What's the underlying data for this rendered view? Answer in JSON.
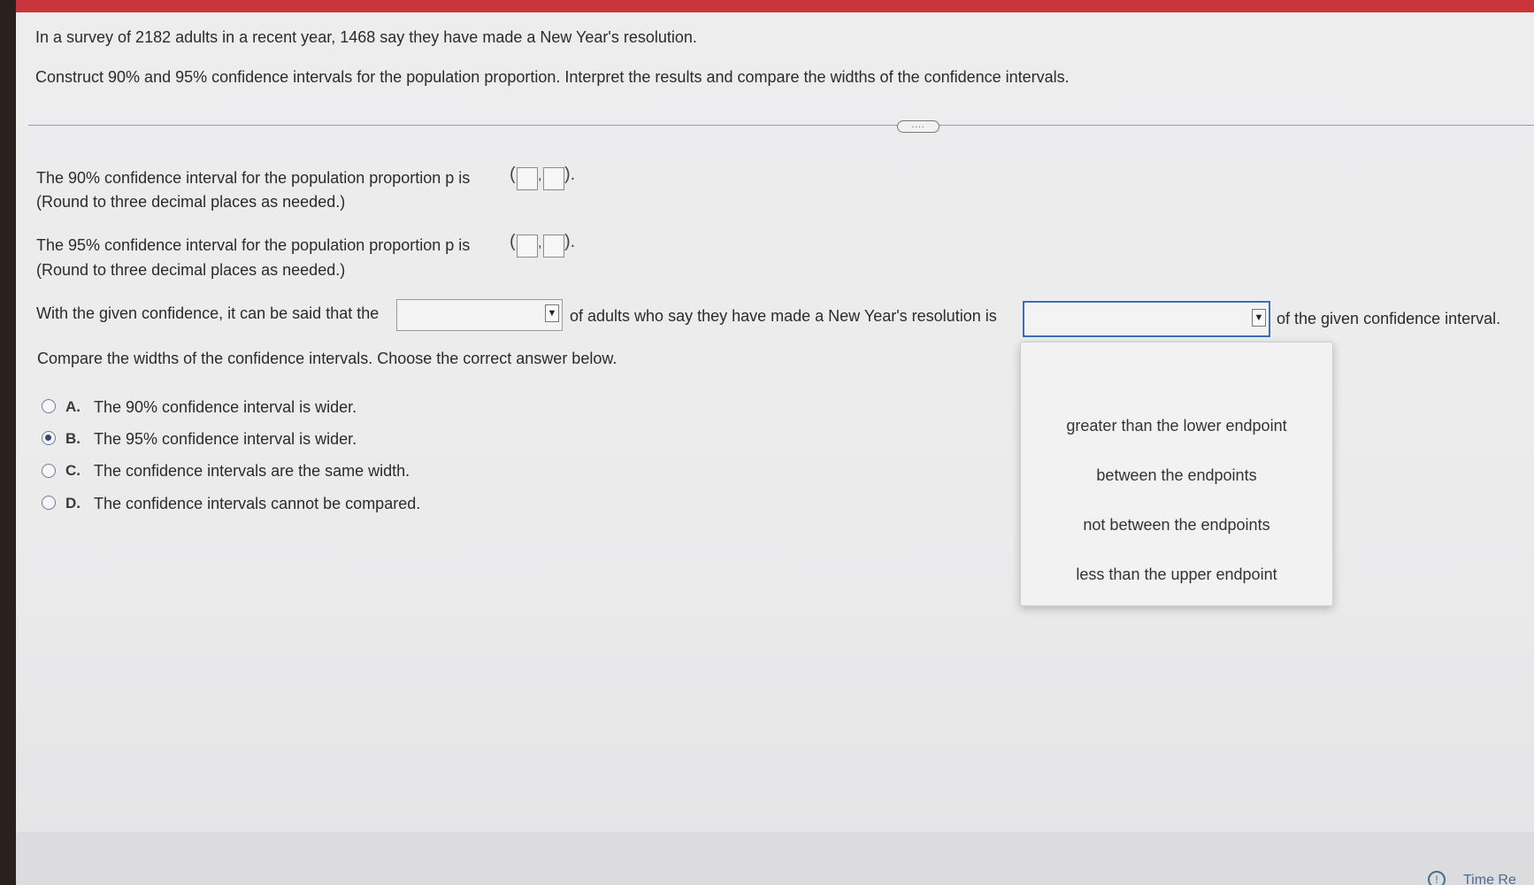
{
  "question": {
    "line1": "In a survey of 2182 adults in a recent year, 1468 say they have made a New Year's resolution.",
    "line2": "Construct 90% and 95% confidence intervals for the population proportion. Interpret the results and compare the widths of the confidence intervals."
  },
  "more_button": "....",
  "part1": {
    "prompt": "The 90% confidence interval for the population proportion p is",
    "note": "(Round to three decimal places as needed.)",
    "lower_value": "",
    "upper_value": ""
  },
  "part2": {
    "prompt": "The 95% confidence interval for the population proportion p is",
    "note": "(Round to three decimal places as needed.)",
    "lower_value": "",
    "upper_value": ""
  },
  "interpretation": {
    "text_before": "With the given confidence, it can be said that the",
    "text_middle": "of adults who say they have made a New Year's resolution is",
    "text_after": "of the given confidence interval.",
    "select1_value": "",
    "select2_value": ""
  },
  "dropdown_options": [
    "greater than the lower endpoint",
    "between the endpoints",
    "not between the endpoints",
    "less than the upper endpoint"
  ],
  "compare": {
    "prompt": "Compare the widths of the confidence intervals. Choose the correct answer below.",
    "options": [
      {
        "letter": "A.",
        "text": "The 90% confidence interval is wider."
      },
      {
        "letter": "B.",
        "text": "The 95% confidence interval is wider."
      },
      {
        "letter": "C.",
        "text": "The confidence intervals are the same width."
      },
      {
        "letter": "D.",
        "text": "The confidence intervals cannot be compared."
      }
    ],
    "selected": "B"
  },
  "footer": {
    "time_label": "Time Re"
  }
}
